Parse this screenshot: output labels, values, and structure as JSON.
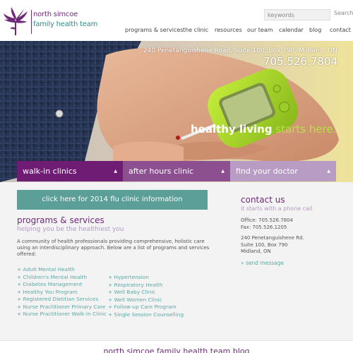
{
  "brand": {
    "line1": "north simcoe",
    "line2": "family health team",
    "purple": "#6e2a78",
    "teal": "#2e8b87"
  },
  "search": {
    "placeholder": "keywords",
    "button_label": "Search"
  },
  "nav": {
    "items": [
      {
        "label": "programs & services"
      },
      {
        "label": "the clinic"
      },
      {
        "label": "resources"
      },
      {
        "label": "our team"
      },
      {
        "label": "calendar"
      },
      {
        "label": "blog"
      },
      {
        "label": "contact"
      }
    ]
  },
  "hero": {
    "address": "240 Penetanguishene Road, Suite 100, Box 790, Midland, ON",
    "phone": "705.526.7804",
    "tagline_white": "healthy living",
    "tagline_green": " starts here."
  },
  "actions": [
    {
      "label": "walk-in clinics",
      "color": "#6e1c74"
    },
    {
      "label": "after hours clinic",
      "color": "#8c5090"
    },
    {
      "label": "find your doctor",
      "color": "#b89cc4"
    }
  ],
  "flu_button": {
    "label": "click here for 2014 flu clinic information",
    "color": "#5b9f98"
  },
  "programs": {
    "title": "programs & services",
    "subtitle": "helping you be the healthiest you",
    "intro": "A community of health professionals providing comprehensive, holistic care using an interdisciplinary approach. Below are a list of programs and services offered:",
    "column1": [
      "+ Adult Mental Health",
      "+ Children's Mental Health",
      "+ Diabetes Management",
      "+ Healthy You Program",
      "+ Registered Dietitian Services",
      "+ Nurse Practitioner Primary Care",
      "+ Nurse Practitioner Walk-in Clinic"
    ],
    "column2": [
      "+ Hypertension",
      "+ Respiratory Health",
      "+ Well Baby Clinic",
      "+ Well Women Clinic",
      "+ Follow-up Care Program",
      "+ Single Session Counselling"
    ]
  },
  "contact": {
    "title": "contact us",
    "subtitle": "it starts with a phone call",
    "office": "Office: 705.526.7804",
    "fax": "Fax: 705.526.1205",
    "address_line1": "240 Penetanguishene Rd.",
    "address_line2": "Suite 100, Box 790",
    "address_line3": "Midland, ON",
    "send_message": "» send message"
  },
  "blog": {
    "title": "north simcoe family health team blog"
  }
}
